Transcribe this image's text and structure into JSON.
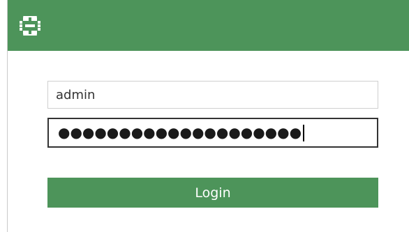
{
  "header": {
    "logo_icon": "fortinet-logo-icon",
    "background_color": "#4d945a"
  },
  "form": {
    "username_value": "admin",
    "password_masked": "●●●●●●●●●●●●●●●●●●●●",
    "login_label": "Login"
  },
  "colors": {
    "accent": "#4d945a",
    "focus_border": "#333333"
  }
}
